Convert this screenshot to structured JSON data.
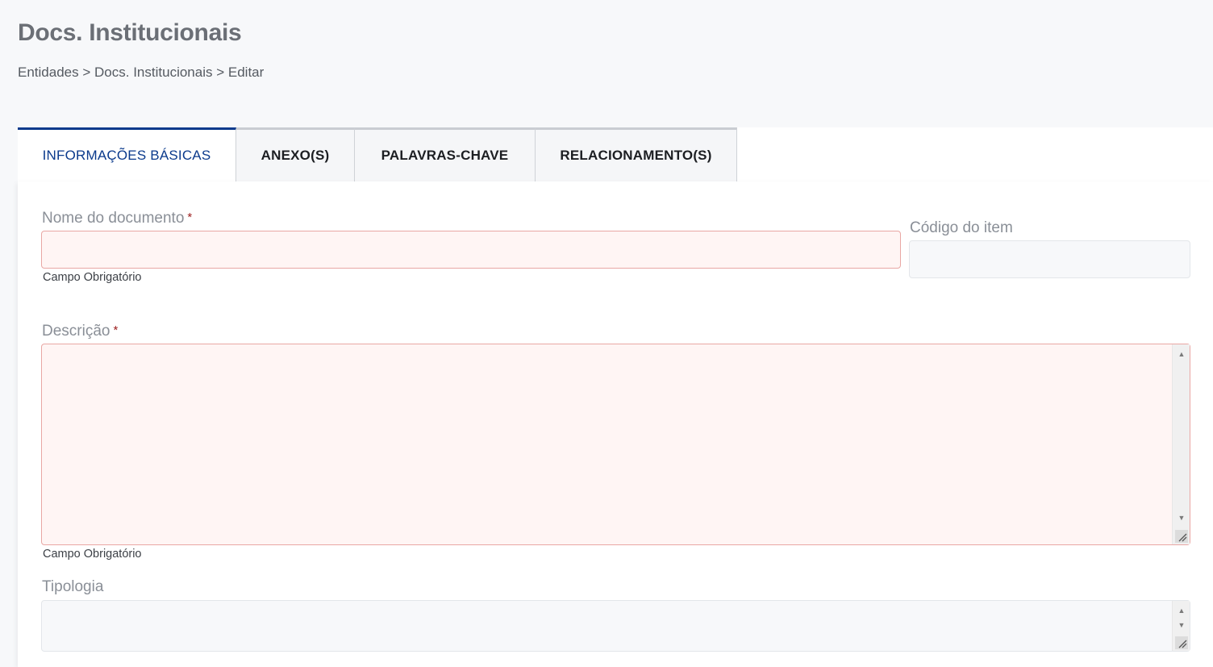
{
  "header": {
    "title": "Docs. Institucionais",
    "breadcrumb": [
      "Entidades",
      ">",
      "Docs. Institucionais",
      ">",
      "Editar"
    ]
  },
  "tabs": [
    {
      "label": "INFORMAÇÕES BÁSICAS",
      "active": true
    },
    {
      "label": "ANEXO(S)",
      "active": false
    },
    {
      "label": "PALAVRAS-CHAVE",
      "active": false
    },
    {
      "label": "RELACIONAMENTO(S)",
      "active": false
    }
  ],
  "form": {
    "nome": {
      "label": "Nome do documento",
      "required_mark": "*",
      "value": "",
      "hint": "Campo Obrigatório"
    },
    "codigo": {
      "label": "Código do item",
      "value": ""
    },
    "descricao": {
      "label": "Descrição",
      "required_mark": "*",
      "value": "",
      "hint": "Campo Obrigatório"
    },
    "tipologia": {
      "label": "Tipologia",
      "value": ""
    }
  },
  "colors": {
    "active_tab": "#0b3a8c",
    "error_border": "#e9a7a4",
    "error_bg": "#fff5f4",
    "required": "#9b1c1c"
  }
}
